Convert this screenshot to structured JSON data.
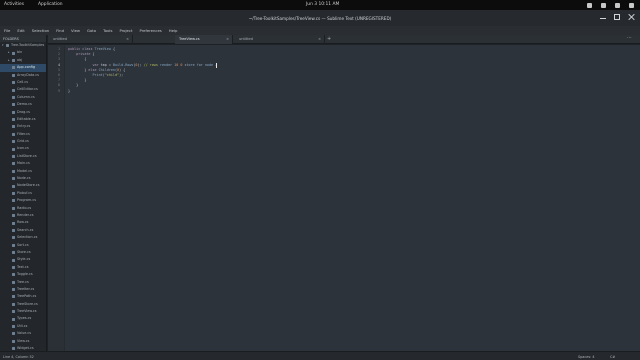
{
  "topbar": {
    "activities": "Activities",
    "app_menu": "Application",
    "clock": "Jun 3  10:11 AM"
  },
  "window": {
    "title": "~/Tree-ToolkitSamples/TreeView.cs — Sublime Text (UNREGISTERED)"
  },
  "menu": [
    "File",
    "Edit",
    "Selection",
    "Find",
    "View",
    "Goto",
    "Tools",
    "Project",
    "Preferences",
    "Help"
  ],
  "sidebar": {
    "header": "FOLDERS",
    "items": [
      {
        "label": "Tree-ToolkitSamples",
        "level": 0,
        "twisty": "▾",
        "selected": false
      },
      {
        "label": "bin",
        "level": 1,
        "twisty": "▸",
        "selected": false
      },
      {
        "label": "obj",
        "level": 1,
        "twisty": "▸",
        "selected": false
      },
      {
        "label": "App.config",
        "level": 1,
        "twisty": "",
        "selected": true
      },
      {
        "label": "ArrayData.cs",
        "level": 1,
        "twisty": "",
        "selected": false
      },
      {
        "label": "Cell.cs",
        "level": 1,
        "twisty": "",
        "selected": false
      },
      {
        "label": "CellEditor.cs",
        "level": 1,
        "twisty": "",
        "selected": false
      },
      {
        "label": "Column.cs",
        "level": 1,
        "twisty": "",
        "selected": false
      },
      {
        "label": "Demo.cs",
        "level": 1,
        "twisty": "",
        "selected": false
      },
      {
        "label": "Drag.cs",
        "level": 1,
        "twisty": "",
        "selected": false
      },
      {
        "label": "Editable.cs",
        "level": 1,
        "twisty": "",
        "selected": false
      },
      {
        "label": "Entry.cs",
        "level": 1,
        "twisty": "",
        "selected": false
      },
      {
        "label": "Filter.cs",
        "level": 1,
        "twisty": "",
        "selected": false
      },
      {
        "label": "Grid.cs",
        "level": 1,
        "twisty": "",
        "selected": false
      },
      {
        "label": "Icon.cs",
        "level": 1,
        "twisty": "",
        "selected": false
      },
      {
        "label": "ListStore.cs",
        "level": 1,
        "twisty": "",
        "selected": false
      },
      {
        "label": "Main.cs",
        "level": 1,
        "twisty": "",
        "selected": false
      },
      {
        "label": "Model.cs",
        "level": 1,
        "twisty": "",
        "selected": false
      },
      {
        "label": "Node.cs",
        "level": 1,
        "twisty": "",
        "selected": false
      },
      {
        "label": "NodeStore.cs",
        "level": 1,
        "twisty": "",
        "selected": false
      },
      {
        "label": "Pixbuf.cs",
        "level": 1,
        "twisty": "",
        "selected": false
      },
      {
        "label": "Program.cs",
        "level": 1,
        "twisty": "",
        "selected": false
      },
      {
        "label": "Radio.cs",
        "level": 1,
        "twisty": "",
        "selected": false
      },
      {
        "label": "Render.cs",
        "level": 1,
        "twisty": "",
        "selected": false
      },
      {
        "label": "Row.cs",
        "level": 1,
        "twisty": "",
        "selected": false
      },
      {
        "label": "Search.cs",
        "level": 1,
        "twisty": "",
        "selected": false
      },
      {
        "label": "Selection.cs",
        "level": 1,
        "twisty": "",
        "selected": false
      },
      {
        "label": "Sort.cs",
        "level": 1,
        "twisty": "",
        "selected": false
      },
      {
        "label": "Store.cs",
        "level": 1,
        "twisty": "",
        "selected": false
      },
      {
        "label": "Style.cs",
        "level": 1,
        "twisty": "",
        "selected": false
      },
      {
        "label": "Text.cs",
        "level": 1,
        "twisty": "",
        "selected": false
      },
      {
        "label": "Toggle.cs",
        "level": 1,
        "twisty": "",
        "selected": false
      },
      {
        "label": "Tree.cs",
        "level": 1,
        "twisty": "",
        "selected": false
      },
      {
        "label": "TreeIter.cs",
        "level": 1,
        "twisty": "",
        "selected": false
      },
      {
        "label": "TreePath.cs",
        "level": 1,
        "twisty": "",
        "selected": false
      },
      {
        "label": "TreeStore.cs",
        "level": 1,
        "twisty": "",
        "selected": false
      },
      {
        "label": "TreeView.cs",
        "level": 1,
        "twisty": "",
        "selected": false
      },
      {
        "label": "Types.cs",
        "level": 1,
        "twisty": "",
        "selected": false
      },
      {
        "label": "Util.cs",
        "level": 1,
        "twisty": "",
        "selected": false
      },
      {
        "label": "Value.cs",
        "level": 1,
        "twisty": "",
        "selected": false
      },
      {
        "label": "View.cs",
        "level": 1,
        "twisty": "",
        "selected": false
      },
      {
        "label": "Widget.cs",
        "level": 1,
        "twisty": "",
        "selected": false
      }
    ]
  },
  "tabs": [
    {
      "label": "untitled",
      "active": false
    },
    {
      "label": "TreeView.cs",
      "active": true
    },
    {
      "label": "untitled",
      "active": false
    }
  ],
  "editor": {
    "lines": [
      {
        "n": "1",
        "html": "<span class=\"kw\">public</span> <span class=\"kw\">class</span> <span class=\"fn\">TreeView</span> {",
        "indent": 0
      },
      {
        "n": "2",
        "html": "    <span class=\"kw\">private</span> {",
        "indent": 0
      },
      {
        "n": "3",
        "html": "        {",
        "indent": 0
      },
      {
        "n": "4",
        "html": "            <span class=\"kw\">var</span> tmp = <span class=\"fn\">Build</span>.<span class=\"fn\">Rows</span>(<span class=\"num\">0</span>); <span class=\"str\">// rows</span> <span class=\"fn\">render</span> <span class=\"num\">10</span> <span class=\"num\">0</span> <span class=\"fn\">store</span> <span class=\"fn\">for</span> <span class=\"fn\">node</span> {",
        "indent": 0
      },
      {
        "n": "5",
        "html": "        } <span class=\"kw\">else</span> <span class=\"fn\">Children</span>(<span class=\"num\">0</span>) {",
        "indent": 0
      },
      {
        "n": "6",
        "html": "            <span class=\"fn\">Print</span>(<span class=\"str\">\"child\"</span>);",
        "indent": 0
      },
      {
        "n": "7",
        "html": "        }",
        "indent": 0
      },
      {
        "n": "8",
        "html": "    }",
        "indent": 0
      },
      {
        "n": "9",
        "html": "}",
        "indent": 0
      }
    ],
    "current_line": "4"
  },
  "status": {
    "left": "Line 4, Column 52",
    "spaces": "Spaces: 4",
    "syntax": "C#"
  }
}
